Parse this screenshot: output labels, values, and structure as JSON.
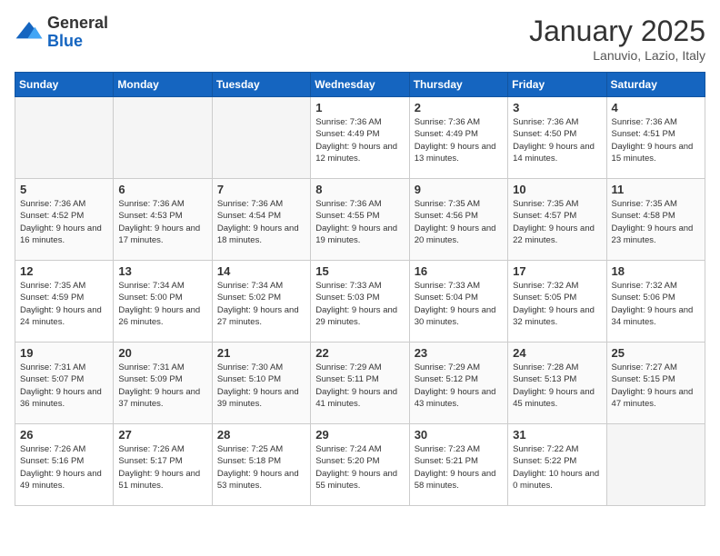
{
  "header": {
    "logo_general": "General",
    "logo_blue": "Blue",
    "month_title": "January 2025",
    "location": "Lanuvio, Lazio, Italy"
  },
  "days_of_week": [
    "Sunday",
    "Monday",
    "Tuesday",
    "Wednesday",
    "Thursday",
    "Friday",
    "Saturday"
  ],
  "weeks": [
    [
      {
        "day": "",
        "empty": true
      },
      {
        "day": "",
        "empty": true
      },
      {
        "day": "",
        "empty": true
      },
      {
        "day": "1",
        "sunrise": "7:36 AM",
        "sunset": "4:49 PM",
        "daylight": "9 hours and 12 minutes."
      },
      {
        "day": "2",
        "sunrise": "7:36 AM",
        "sunset": "4:49 PM",
        "daylight": "9 hours and 13 minutes."
      },
      {
        "day": "3",
        "sunrise": "7:36 AM",
        "sunset": "4:50 PM",
        "daylight": "9 hours and 14 minutes."
      },
      {
        "day": "4",
        "sunrise": "7:36 AM",
        "sunset": "4:51 PM",
        "daylight": "9 hours and 15 minutes."
      }
    ],
    [
      {
        "day": "5",
        "sunrise": "7:36 AM",
        "sunset": "4:52 PM",
        "daylight": "9 hours and 16 minutes."
      },
      {
        "day": "6",
        "sunrise": "7:36 AM",
        "sunset": "4:53 PM",
        "daylight": "9 hours and 17 minutes."
      },
      {
        "day": "7",
        "sunrise": "7:36 AM",
        "sunset": "4:54 PM",
        "daylight": "9 hours and 18 minutes."
      },
      {
        "day": "8",
        "sunrise": "7:36 AM",
        "sunset": "4:55 PM",
        "daylight": "9 hours and 19 minutes."
      },
      {
        "day": "9",
        "sunrise": "7:35 AM",
        "sunset": "4:56 PM",
        "daylight": "9 hours and 20 minutes."
      },
      {
        "day": "10",
        "sunrise": "7:35 AM",
        "sunset": "4:57 PM",
        "daylight": "9 hours and 22 minutes."
      },
      {
        "day": "11",
        "sunrise": "7:35 AM",
        "sunset": "4:58 PM",
        "daylight": "9 hours and 23 minutes."
      }
    ],
    [
      {
        "day": "12",
        "sunrise": "7:35 AM",
        "sunset": "4:59 PM",
        "daylight": "9 hours and 24 minutes."
      },
      {
        "day": "13",
        "sunrise": "7:34 AM",
        "sunset": "5:00 PM",
        "daylight": "9 hours and 26 minutes."
      },
      {
        "day": "14",
        "sunrise": "7:34 AM",
        "sunset": "5:02 PM",
        "daylight": "9 hours and 27 minutes."
      },
      {
        "day": "15",
        "sunrise": "7:33 AM",
        "sunset": "5:03 PM",
        "daylight": "9 hours and 29 minutes."
      },
      {
        "day": "16",
        "sunrise": "7:33 AM",
        "sunset": "5:04 PM",
        "daylight": "9 hours and 30 minutes."
      },
      {
        "day": "17",
        "sunrise": "7:32 AM",
        "sunset": "5:05 PM",
        "daylight": "9 hours and 32 minutes."
      },
      {
        "day": "18",
        "sunrise": "7:32 AM",
        "sunset": "5:06 PM",
        "daylight": "9 hours and 34 minutes."
      }
    ],
    [
      {
        "day": "19",
        "sunrise": "7:31 AM",
        "sunset": "5:07 PM",
        "daylight": "9 hours and 36 minutes."
      },
      {
        "day": "20",
        "sunrise": "7:31 AM",
        "sunset": "5:09 PM",
        "daylight": "9 hours and 37 minutes."
      },
      {
        "day": "21",
        "sunrise": "7:30 AM",
        "sunset": "5:10 PM",
        "daylight": "9 hours and 39 minutes."
      },
      {
        "day": "22",
        "sunrise": "7:29 AM",
        "sunset": "5:11 PM",
        "daylight": "9 hours and 41 minutes."
      },
      {
        "day": "23",
        "sunrise": "7:29 AM",
        "sunset": "5:12 PM",
        "daylight": "9 hours and 43 minutes."
      },
      {
        "day": "24",
        "sunrise": "7:28 AM",
        "sunset": "5:13 PM",
        "daylight": "9 hours and 45 minutes."
      },
      {
        "day": "25",
        "sunrise": "7:27 AM",
        "sunset": "5:15 PM",
        "daylight": "9 hours and 47 minutes."
      }
    ],
    [
      {
        "day": "26",
        "sunrise": "7:26 AM",
        "sunset": "5:16 PM",
        "daylight": "9 hours and 49 minutes."
      },
      {
        "day": "27",
        "sunrise": "7:26 AM",
        "sunset": "5:17 PM",
        "daylight": "9 hours and 51 minutes."
      },
      {
        "day": "28",
        "sunrise": "7:25 AM",
        "sunset": "5:18 PM",
        "daylight": "9 hours and 53 minutes."
      },
      {
        "day": "29",
        "sunrise": "7:24 AM",
        "sunset": "5:20 PM",
        "daylight": "9 hours and 55 minutes."
      },
      {
        "day": "30",
        "sunrise": "7:23 AM",
        "sunset": "5:21 PM",
        "daylight": "9 hours and 58 minutes."
      },
      {
        "day": "31",
        "sunrise": "7:22 AM",
        "sunset": "5:22 PM",
        "daylight": "10 hours and 0 minutes."
      },
      {
        "day": "",
        "empty": true
      }
    ]
  ]
}
